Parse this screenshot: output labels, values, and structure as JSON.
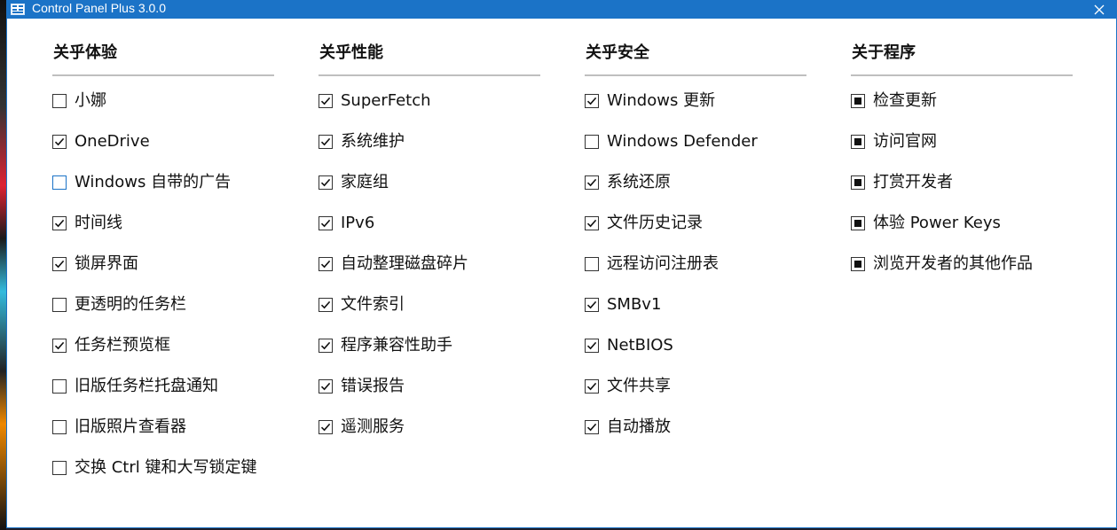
{
  "window": {
    "title": "Control Panel Plus 3.0.0"
  },
  "colors": {
    "titlebar": "#1b73c7",
    "text": "#111111",
    "rule": "#bfbfbf"
  },
  "columns": [
    {
      "heading": "关乎体验",
      "items": [
        {
          "label": "小娜",
          "checked": false
        },
        {
          "label": "OneDrive",
          "checked": true
        },
        {
          "label": "Windows 自带的广告",
          "checked": false,
          "focused": true
        },
        {
          "label": "时间线",
          "checked": true
        },
        {
          "label": "锁屏界面",
          "checked": true
        },
        {
          "label": "更透明的任务栏",
          "checked": false
        },
        {
          "label": "任务栏预览框",
          "checked": true
        },
        {
          "label": "旧版任务栏托盘通知",
          "checked": false
        },
        {
          "label": "旧版照片查看器",
          "checked": false
        },
        {
          "label": "交换 Ctrl 键和大写锁定键",
          "checked": false
        }
      ]
    },
    {
      "heading": "关乎性能",
      "items": [
        {
          "label": "SuperFetch",
          "checked": true
        },
        {
          "label": "系统维护",
          "checked": true
        },
        {
          "label": "家庭组",
          "checked": true
        },
        {
          "label": "IPv6",
          "checked": true
        },
        {
          "label": "自动整理磁盘碎片",
          "checked": true
        },
        {
          "label": "文件索引",
          "checked": true
        },
        {
          "label": "程序兼容性助手",
          "checked": true
        },
        {
          "label": "错误报告",
          "checked": true
        },
        {
          "label": "遥测服务",
          "checked": true
        }
      ]
    },
    {
      "heading": "关乎安全",
      "items": [
        {
          "label": "Windows 更新",
          "checked": true
        },
        {
          "label": "Windows Defender",
          "checked": false
        },
        {
          "label": "系统还原",
          "checked": true
        },
        {
          "label": "文件历史记录",
          "checked": true
        },
        {
          "label": "远程访问注册表",
          "checked": false
        },
        {
          "label": "SMBv1",
          "checked": true
        },
        {
          "label": "NetBIOS",
          "checked": true
        },
        {
          "label": "文件共享",
          "checked": true
        },
        {
          "label": "自动播放",
          "checked": true
        }
      ]
    },
    {
      "heading": "关于程序",
      "items": [
        {
          "label": "检查更新",
          "action": true
        },
        {
          "label": "访问官网",
          "action": true
        },
        {
          "label": "打赏开发者",
          "action": true
        },
        {
          "label": "体验 Power Keys",
          "action": true
        },
        {
          "label": "浏览开发者的其他作品",
          "action": true
        }
      ]
    }
  ]
}
